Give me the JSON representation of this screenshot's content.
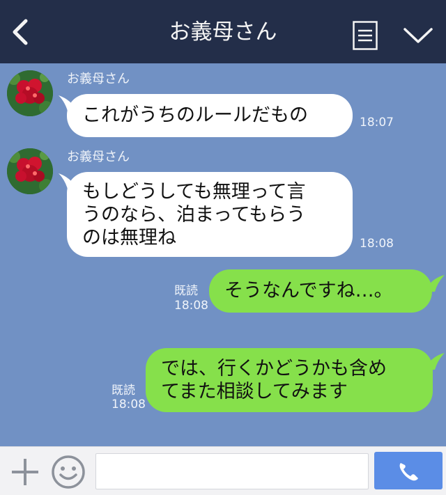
{
  "header": {
    "title": "お義母さん"
  },
  "messages": [
    {
      "direction": "incoming",
      "sender": "お義母さん",
      "lines": [
        "これがうちのルールだもの"
      ],
      "time": "18:07"
    },
    {
      "direction": "incoming",
      "sender": "お義母さん",
      "lines": [
        "もしどうしても無理って言",
        "うのなら、泊まってもらう",
        "のは無理ね"
      ],
      "time": "18:08"
    },
    {
      "direction": "outgoing",
      "lines": [
        "そうなんですね…。"
      ],
      "read": "既読",
      "time": "18:08"
    },
    {
      "direction": "outgoing",
      "lines": [
        "では、行くかどうかも含め",
        "てまた相談してみます"
      ],
      "read": "既読",
      "time": "18:08"
    }
  ],
  "input": {
    "placeholder": ""
  },
  "colors": {
    "header_bg": "#232e49",
    "chat_bg": "#7191c4",
    "incoming_bubble": "#ffffff",
    "outgoing_bubble": "#86e04b",
    "call_button": "#5b8de6"
  },
  "icons": {
    "back": "chevron-left-icon",
    "menu": "menu-lines-icon",
    "collapse": "chevron-down-icon",
    "plus": "plus-icon",
    "emoji": "smiley-icon",
    "call": "phone-icon",
    "avatar": "red-flower-avatar"
  }
}
